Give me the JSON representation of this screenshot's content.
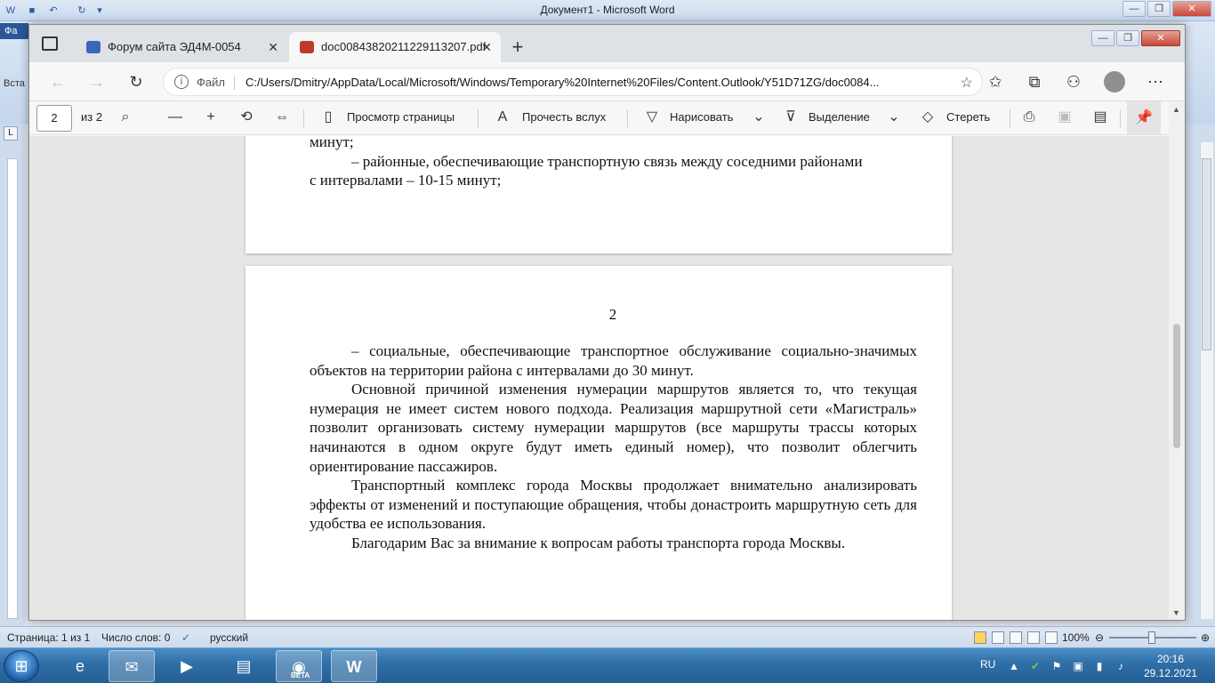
{
  "word": {
    "title": "Документ1  -  Microsoft Word",
    "file_tab": "Фа",
    "paste_label": "Вста",
    "status": {
      "page": "Страница: 1 из 1",
      "words": "Число слов: 0",
      "language": "русский",
      "zoom": "100%"
    }
  },
  "edge": {
    "tabs": [
      {
        "label": "Форум сайта ЭД4М-0054",
        "icon": "site-icon",
        "active": false
      },
      {
        "label": "doc00843820211229113207.pdf",
        "icon": "pdf-icon",
        "active": true
      }
    ],
    "address": {
      "info_label": "Файл",
      "url": "C:/Users/Dmitry/AppData/Local/Microsoft/Windows/Temporary%20Internet%20Files/Content.Outlook/Y51D71ZG/doc0084..."
    },
    "pdf_toolbar": {
      "page_number": "2",
      "page_count": "из 2",
      "page_view": "Просмотр страницы",
      "read_aloud": "Прочесть вслух",
      "draw": "Нарисовать",
      "highlight": "Выделение",
      "erase": "Стереть"
    }
  },
  "document": {
    "page1_tail": {
      "line0": "минут;",
      "line1": "– районные, обеспечивающие транспортную связь между соседними районами",
      "line2": "с интервалами – 10-15 минут;"
    },
    "page2": {
      "page_number": "2",
      "p1": "– социальные, обеспечивающие транспортное обслуживание социально-значимых объектов на территории района с интервалами до 30 минут.",
      "p2": "Основной причиной изменения нумерации маршрутов является то, что текущая нумерация не имеет систем нового подхода. Реализация маршрутной сети «Магистраль» позволит организовать систему нумерации маршрутов (все маршруты трассы которых начинаются в одном округе будут иметь единый номер), что позволит облегчить ориентирование пассажиров.",
      "p3": "Транспортный комплекс города Москвы продолжает внимательно анализировать эффекты от изменений и поступающие обращения, чтобы донастроить маршрутную сеть для удобства ее использования.",
      "p4": "Благодарим Вас за внимание к вопросам работы транспорта города Москвы."
    }
  },
  "taskbar": {
    "apps": [
      "internet-explorer",
      "outlook",
      "media-player",
      "explorer",
      "edge-beta",
      "word"
    ],
    "edge_badge": "BETA",
    "language": "RU",
    "time": "20:16",
    "date": "29.12.2021"
  },
  "colors": {
    "edge_tabbar": "#dee1e6",
    "pdf_background": "#e6e6e6",
    "taskbar": "#2f6ea6",
    "pdf_icon": "#c0392b"
  }
}
